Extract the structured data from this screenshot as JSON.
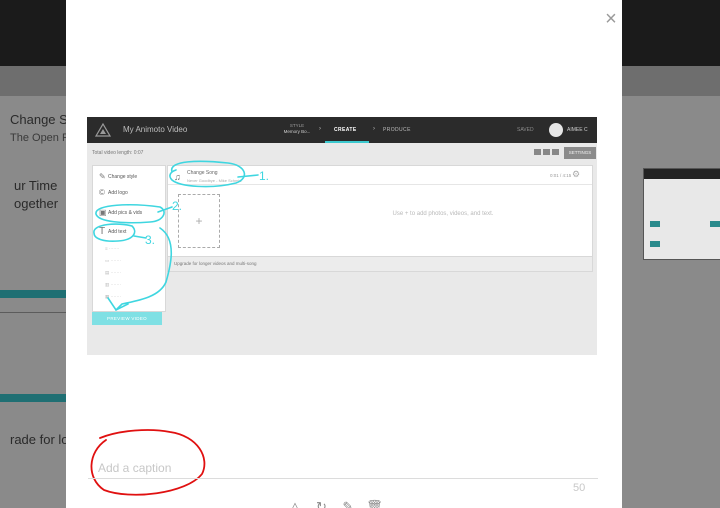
{
  "background": {
    "left_texts": [
      "Change So",
      "The Open Ro",
      "ur Time",
      "ogether",
      "rade for lo"
    ]
  },
  "modal": {
    "close_glyph": "×",
    "caption": {
      "placeholder": "Add a caption",
      "value": "",
      "remaining": "50"
    },
    "bottom_icons": [
      "triangle-icon",
      "rotate-icon",
      "pencil-icon",
      "trash-icon"
    ]
  },
  "screenshot": {
    "app_title": "My Animoto Video",
    "nav": {
      "style_label": "STYLE",
      "style_value": "Memory Bo...",
      "create": "CREATE",
      "produce": "PRODUCE",
      "saved": "SAVED",
      "user": "AIMEE C"
    },
    "length_label": "Total video length: 0:07",
    "settings": "SETTINGS",
    "sidebar": {
      "change_style": "Change style",
      "add_logo": "Add logo",
      "add_pics": "Add pics & vids",
      "add_text": "Add text",
      "preview": "PREVIEW VIDEO"
    },
    "song": {
      "title": "Change Song",
      "subtitle": "Never Goodbye - Mike Schmid",
      "duration": "0:01 / 4:15"
    },
    "hint": "Use + to add photos, videos, and text.",
    "upgrade": "Upgrade for longer videos and multi-song"
  },
  "annotations": {
    "n1": "1.",
    "n2": "2.",
    "n3": "3."
  },
  "colors": {
    "annotation_cyan": "#3fd6e0",
    "annotation_red": "#e01010",
    "create_accent": "#3cc9cf"
  }
}
